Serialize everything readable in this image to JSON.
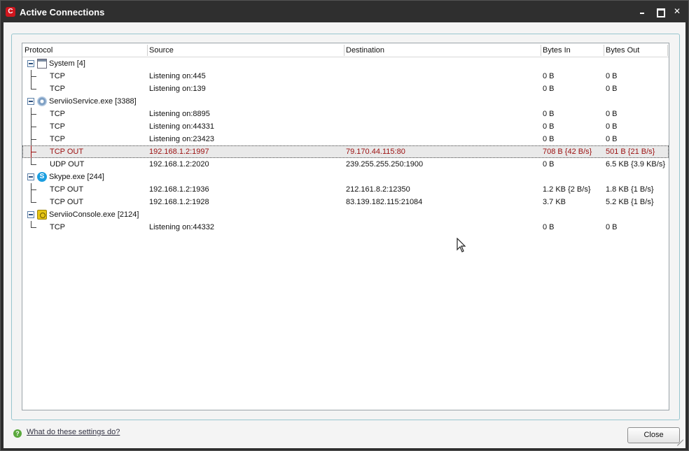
{
  "window": {
    "title": "Active Connections",
    "logo_letter": "C"
  },
  "columns": {
    "protocol": "Protocol",
    "source": "Source",
    "destination": "Destination",
    "bytes_in": "Bytes In",
    "bytes_out": "Bytes Out"
  },
  "groups": [
    {
      "label": "System [4]",
      "icon": "window-icon",
      "rows": [
        {
          "protocol": "TCP",
          "source": "Listening on:445",
          "destination": "",
          "bytes_in": "0 B",
          "bytes_out": "0 B"
        },
        {
          "protocol": "TCP",
          "source": "Listening on:139",
          "destination": "",
          "bytes_in": "0 B",
          "bytes_out": "0 B"
        }
      ]
    },
    {
      "label": "ServiioService.exe [3388]",
      "icon": "gear-icon",
      "rows": [
        {
          "protocol": "TCP",
          "source": "Listening on:8895",
          "destination": "",
          "bytes_in": "0 B",
          "bytes_out": "0 B"
        },
        {
          "protocol": "TCP",
          "source": "Listening on:44331",
          "destination": "",
          "bytes_in": "0 B",
          "bytes_out": "0 B"
        },
        {
          "protocol": "TCP",
          "source": "Listening on:23423",
          "destination": "",
          "bytes_in": "0 B",
          "bytes_out": "0 B"
        },
        {
          "protocol": "TCP OUT",
          "source": "192.168.1.2:1997",
          "destination": "79.170.44.115:80",
          "bytes_in": "708 B {42 B/s}",
          "bytes_out": "501 B {21 B/s}",
          "selected": true
        },
        {
          "protocol": "UDP OUT",
          "source": "192.168.1.2:2020",
          "destination": "239.255.255.250:1900",
          "bytes_in": "0 B",
          "bytes_out": "6.5 KB {3.9 KB/s}"
        }
      ]
    },
    {
      "label": "Skype.exe [244]",
      "icon": "skype-icon",
      "icon_glyph": "S",
      "rows": [
        {
          "protocol": "TCP OUT",
          "source": "192.168.1.2:1936",
          "destination": "212.161.8.2:12350",
          "bytes_in": "1.2 KB {2 B/s}",
          "bytes_out": "1.8 KB {1 B/s}"
        },
        {
          "protocol": "TCP OUT",
          "source": "192.168.1.2:1928",
          "destination": "83.139.182.115:21084",
          "bytes_in": "3.7 KB",
          "bytes_out": "5.2 KB {1 B/s}"
        }
      ]
    },
    {
      "label": "ServiioConsole.exe [2124]",
      "icon": "console-icon",
      "rows": [
        {
          "protocol": "TCP",
          "source": "Listening on:44332",
          "destination": "",
          "bytes_in": "0 B",
          "bytes_out": "0 B"
        }
      ]
    }
  ],
  "footer": {
    "help_link": "What do these settings do?",
    "help_icon_glyph": "?",
    "close_label": "Close"
  },
  "colors": {
    "selected_text": "#9c1010",
    "titlebar": "#2f2f2f",
    "panel_border": "#98c6cf"
  }
}
